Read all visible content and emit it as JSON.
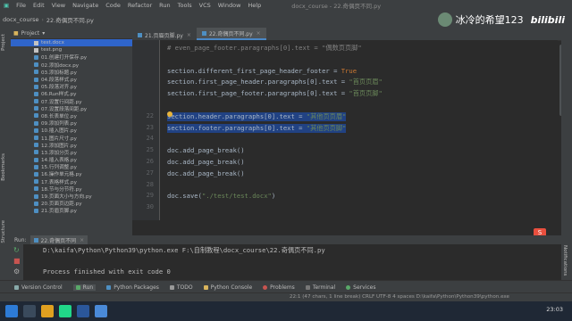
{
  "menu": {
    "items": [
      "File",
      "Edit",
      "View",
      "Navigate",
      "Code",
      "Refactor",
      "Run",
      "Tools",
      "VCS",
      "Window",
      "Help"
    ],
    "window_title": "docx_course - 22.奇偶页不同.py"
  },
  "breadcrumb": [
    "docx_course",
    "22.奇偶页不同.py"
  ],
  "watermark": {
    "author": "冰冷的希望123",
    "site": "bilibili"
  },
  "project": {
    "header": "Project",
    "items": [
      {
        "label": "test.docx",
        "kind": "file",
        "selected": true
      },
      {
        "label": "test.png",
        "kind": "file",
        "selected": false
      },
      {
        "label": "01.创建打开保存.py",
        "kind": "py",
        "selected": false
      },
      {
        "label": "02.添加docx.py",
        "kind": "py",
        "selected": false
      },
      {
        "label": "03.添加标题.py",
        "kind": "py",
        "selected": false
      },
      {
        "label": "04.段落样式.py",
        "kind": "py",
        "selected": false
      },
      {
        "label": "05.段落对齐.py",
        "kind": "py",
        "selected": false
      },
      {
        "label": "06.Run样式.py",
        "kind": "py",
        "selected": false
      },
      {
        "label": "07.设置行间距.py",
        "kind": "py",
        "selected": false
      },
      {
        "label": "07.设置段落间距.py",
        "kind": "py",
        "selected": false
      },
      {
        "label": "08.长表单位.py",
        "kind": "py",
        "selected": false
      },
      {
        "label": "09.添加列表.py",
        "kind": "py",
        "selected": false
      },
      {
        "label": "10.插入图片.py",
        "kind": "py",
        "selected": false
      },
      {
        "label": "11.图片尺寸.py",
        "kind": "py",
        "selected": false
      },
      {
        "label": "12.添加图片.py",
        "kind": "py",
        "selected": false
      },
      {
        "label": "13.添加分页.py",
        "kind": "py",
        "selected": false
      },
      {
        "label": "14.插入表格.py",
        "kind": "py",
        "selected": false
      },
      {
        "label": "15.行列调整.py",
        "kind": "py",
        "selected": false
      },
      {
        "label": "16.操作单元格.py",
        "kind": "py",
        "selected": false
      },
      {
        "label": "17.表格样式.py",
        "kind": "py",
        "selected": false
      },
      {
        "label": "18.节与分节符.py",
        "kind": "py",
        "selected": false
      },
      {
        "label": "19.页面大小与方向.py",
        "kind": "py",
        "selected": false
      },
      {
        "label": "20.页面页边距.py",
        "kind": "py",
        "selected": false
      },
      {
        "label": "21.页眉页脚.py",
        "kind": "py",
        "selected": false
      }
    ]
  },
  "tabs": [
    {
      "label": "21.页眉页脚.py",
      "active": false
    },
    {
      "label": "22.奇偶页不同.py",
      "active": true
    }
  ],
  "editor": {
    "lines": [
      {
        "num": "",
        "text": "# even_page_footer.paragraphs[0].text = \"偶数页页脚\"",
        "style": "cm",
        "selected": false
      },
      {
        "num": "",
        "text": "",
        "style": "",
        "selected": false
      },
      {
        "num": "",
        "text": "section.different_first_page_header_footer = True",
        "style": "",
        "selected": false
      },
      {
        "num": "",
        "text": "section.first_page_header.paragraphs[0].text = \"首页页眉\"",
        "style": "",
        "selected": false
      },
      {
        "num": "",
        "text": "section.first_page_footer.paragraphs[0].text = \"首页页脚\"",
        "style": "",
        "selected": false
      },
      {
        "num": "",
        "text": "",
        "style": "",
        "selected": false
      },
      {
        "num": "22",
        "text": "section.header.paragraphs[0].text = \"其他页页眉\"",
        "style": "",
        "selected": true
      },
      {
        "num": "23",
        "text": "section.footer.paragraphs[0].text = \"其他页页脚\"",
        "style": "",
        "selected": true
      },
      {
        "num": "24",
        "text": "",
        "style": "",
        "selected": false
      },
      {
        "num": "25",
        "text": "doc.add_page_break()",
        "style": "",
        "selected": false
      },
      {
        "num": "26",
        "text": "doc.add_page_break()",
        "style": "",
        "selected": false
      },
      {
        "num": "27",
        "text": "doc.add_page_break()",
        "style": "",
        "selected": false
      },
      {
        "num": "28",
        "text": "",
        "style": "",
        "selected": false
      },
      {
        "num": "29",
        "text": "doc.save(\"./test/test.docx\")",
        "style": "",
        "selected": false
      },
      {
        "num": "30",
        "text": "",
        "style": "",
        "selected": false
      }
    ]
  },
  "run": {
    "label": "Run:",
    "tab": "22.奇偶页不同",
    "lines": [
      "D:\\kaifa\\Python\\Python39\\python.exe F:\\自制教程\\docx_course\\22.奇偶页不同.py",
      "",
      "Process finished with exit code 0"
    ]
  },
  "bottom_tools": [
    "Version Control",
    "Run",
    "Python Packages",
    "TODO",
    "Python Console",
    "Problems",
    "Terminal",
    "Services"
  ],
  "status": {
    "text": "22:1 (47 chars, 1 line break)  CRLF  UTF-8  4 spaces  D:\\kaifa\\Python\\Python39\\python.exe",
    "clock": "23:03"
  },
  "side_tabs": {
    "left_top": "Project",
    "left_mid": "Structure",
    "left_bottom": "Bookmarks",
    "right": "Notifications"
  },
  "ime": {
    "label": "S"
  }
}
